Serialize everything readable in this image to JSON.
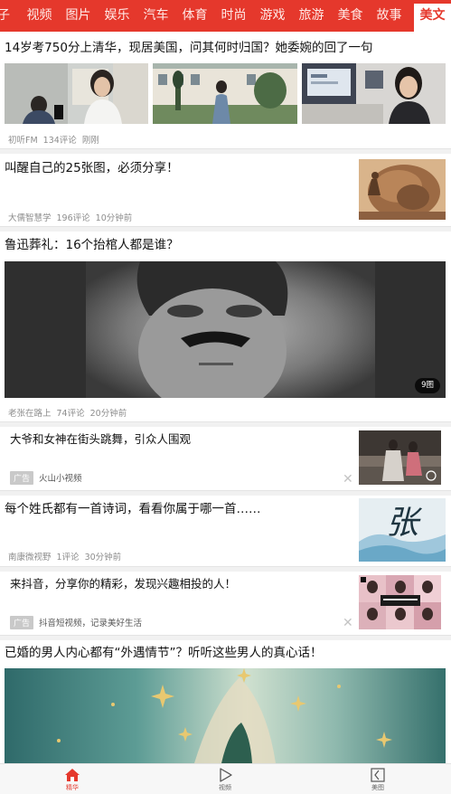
{
  "nav": {
    "tabs": [
      "子",
      "视频",
      "图片",
      "娱乐",
      "汽车",
      "体育",
      "时尚",
      "游戏",
      "旅游",
      "美食",
      "故事"
    ],
    "active_tab": "美文"
  },
  "feed": [
    {
      "title": "14岁考750分上清华，现居美国，问其何时归国？她委婉的回了一句",
      "source": "初听FM",
      "comments": "134评论",
      "time": "刚刚"
    },
    {
      "title": "叫醒自己的25张图，必须分享！",
      "source": "大儒智慧学",
      "comments": "196评论",
      "time": "10分钟前"
    },
    {
      "title": "鲁迅葬礼：16个抬棺人都是谁？",
      "source": "老张在路上",
      "comments": "74评论",
      "time": "20分钟前",
      "image_count": "9图"
    },
    {
      "title": "大爷和女神在街头跳舞，引众人围观",
      "ad_label": "广告",
      "source": "火山小视频",
      "close": "✕"
    },
    {
      "title": "每个姓氏都有一首诗词，看看你属于哪一首……",
      "source": "南康微视野",
      "comments": "1评论",
      "time": "30分钟前",
      "thumb_text": "张"
    },
    {
      "title": "来抖音，分享你的精彩，发现兴趣相投的人！",
      "ad_label": "广告",
      "source": "抖音短视频，记录美好生活",
      "close": "✕"
    },
    {
      "title": "已婚的男人内心都有“外遇情节”？听听这些男人的真心话！"
    }
  ],
  "bottom_tabs": [
    {
      "label": "精华",
      "icon": "home-icon",
      "active": true
    },
    {
      "label": "视频",
      "icon": "play-icon",
      "active": false
    },
    {
      "label": "美图",
      "icon": "picture-icon",
      "active": false
    }
  ],
  "colors": {
    "accent": "#e5382c",
    "divider": "#f1f1f1",
    "meta_text": "#8d8d8d"
  }
}
